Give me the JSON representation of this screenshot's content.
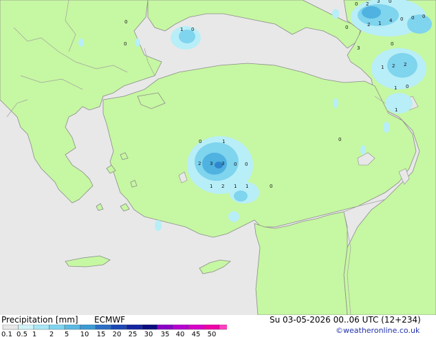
{
  "footer": {
    "product": "Precipitation [mm]",
    "model": "ECMWF",
    "valid_time": "Su 03-05-2026 00..06 UTC (12+234)",
    "credit": "©weatheronline.co.uk"
  },
  "colors": {
    "sea": "#e8e8e8",
    "land": "#c6f7a2",
    "border": "#9a9a9a",
    "precip_light": "#b8eef7",
    "precip_mid": "#7fd4ee",
    "precip_heavy": "#4fb2e0",
    "precip_max": "#2e86cc"
  },
  "legend": {
    "ticks": [
      "0.1",
      "0.5",
      "1",
      "2",
      "5",
      "10",
      "15",
      "20",
      "25",
      "30",
      "35",
      "40",
      "45",
      "50"
    ],
    "colors": [
      "#e8e8e8",
      "#d0f4fa",
      "#a8e6f6",
      "#7fd4ee",
      "#5ab9e2",
      "#3c9ad4",
      "#2a6fc4",
      "#1c48b4",
      "#1424a0",
      "#0c0c80",
      "#8a00c8",
      "#b400d0",
      "#d800c8",
      "#f000a8",
      "#ff40c0"
    ]
  },
  "values": [
    {
      "text": "0"
    },
    {
      "text": "1"
    },
    {
      "text": "0"
    },
    {
      "text": "0"
    },
    {
      "text": "0"
    },
    {
      "text": "2"
    },
    {
      "text": "3"
    },
    {
      "text": "0"
    },
    {
      "text": "0"
    },
    {
      "text": "2"
    },
    {
      "text": "1"
    },
    {
      "text": "4"
    },
    {
      "text": "0"
    },
    {
      "text": "0"
    },
    {
      "text": "0"
    },
    {
      "text": "3"
    },
    {
      "text": "0"
    },
    {
      "text": "1"
    },
    {
      "text": "2"
    },
    {
      "text": "2"
    },
    {
      "text": "1"
    },
    {
      "text": "0"
    },
    {
      "text": "1"
    },
    {
      "text": "0"
    },
    {
      "text": "1"
    },
    {
      "text": "2"
    },
    {
      "text": "3"
    },
    {
      "text": "3"
    },
    {
      "text": "0"
    },
    {
      "text": "0"
    },
    {
      "text": "1"
    },
    {
      "text": "2"
    },
    {
      "text": "1"
    },
    {
      "text": "1"
    },
    {
      "text": "0"
    },
    {
      "text": "0"
    }
  ]
}
